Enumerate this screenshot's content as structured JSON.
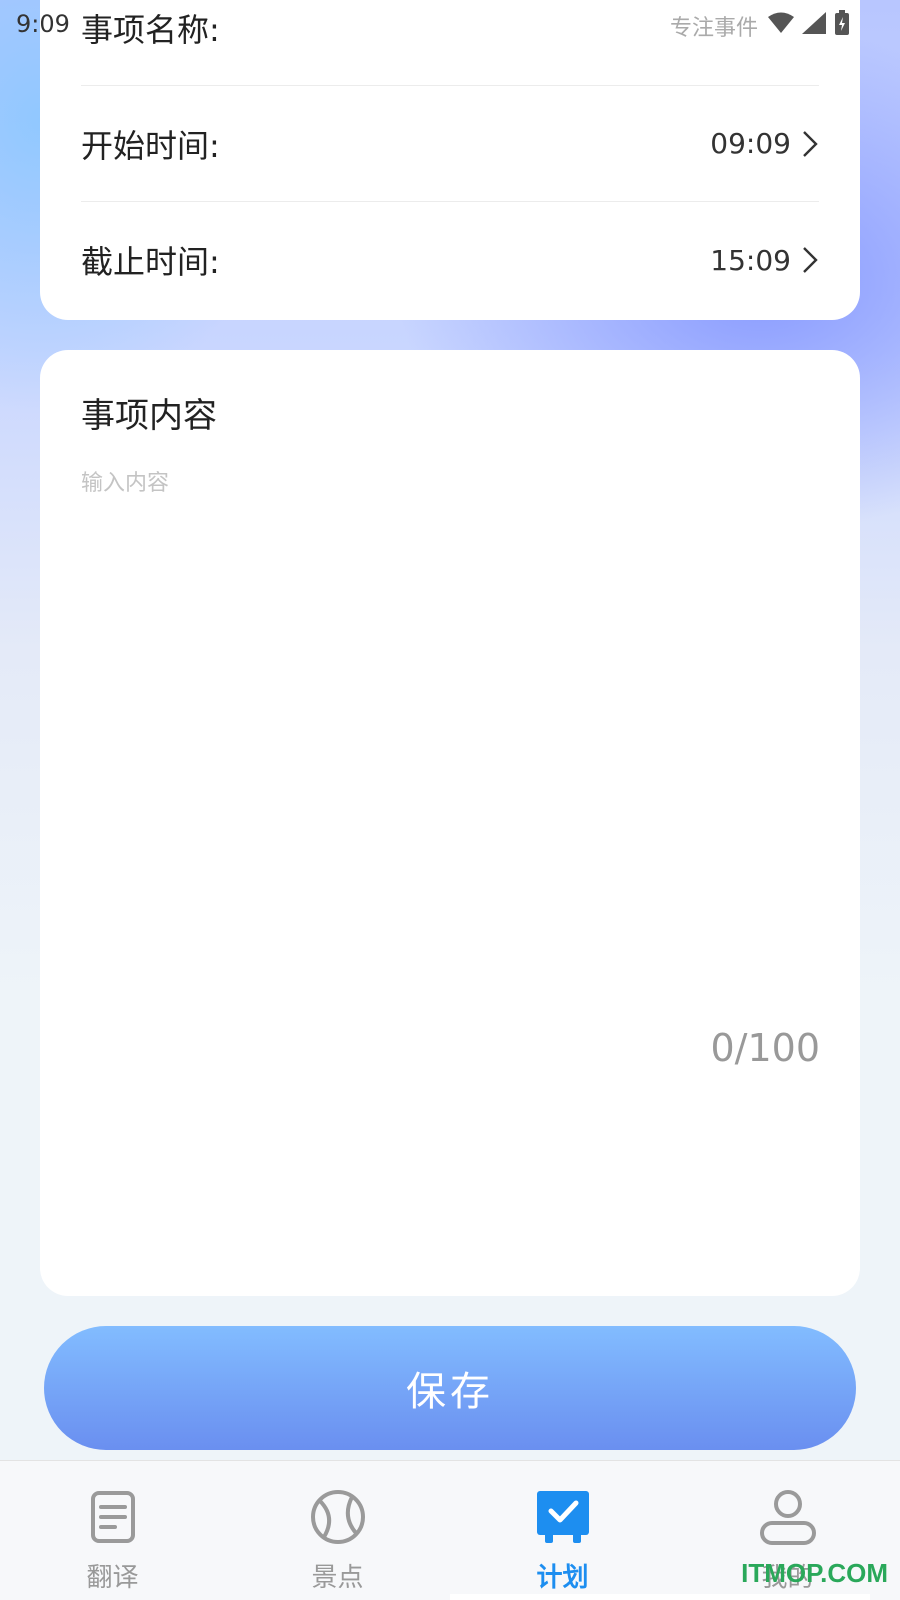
{
  "status_bar": {
    "time": "9:09",
    "hint": "专注事件",
    "icons": [
      "wifi-icon",
      "signal-icon",
      "battery-charging-icon"
    ]
  },
  "form": {
    "name_label": "事项名称:",
    "start_label": "开始时间:",
    "start_value": "09:09",
    "end_label": "截止时间:",
    "end_value": "15:09"
  },
  "content": {
    "title": "事项内容",
    "placeholder": "输入内容",
    "counter": "0/100"
  },
  "save_button": "保存",
  "tabbar": {
    "items": [
      {
        "label": "翻译",
        "icon": "document-icon",
        "active": false
      },
      {
        "label": "景点",
        "icon": "ball-icon",
        "active": false
      },
      {
        "label": "计划",
        "icon": "checkbox-icon",
        "active": true
      },
      {
        "label": "我的",
        "icon": "person-icon",
        "active": false
      }
    ]
  },
  "watermark": "ITMOP.COM",
  "colors": {
    "accent": "#1d8ef0",
    "button_top": "#82bcff",
    "button_bottom": "#6a8ff0"
  }
}
